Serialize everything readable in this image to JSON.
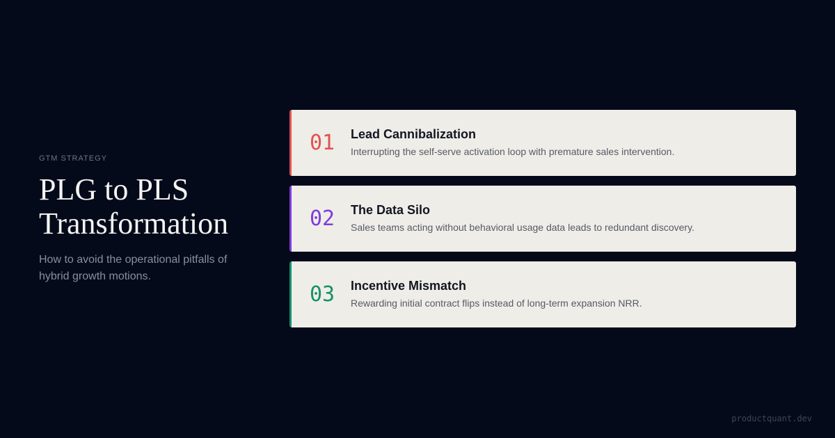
{
  "left": {
    "eyebrow": "GTM STRATEGY",
    "title_line1": "PLG to PLS",
    "title_line2": "Transformation",
    "subtitle": "How to avoid the operational pitfalls of hybrid growth motions."
  },
  "cards": [
    {
      "number": "01",
      "title": "Lead Cannibalization",
      "description": "Interrupting the self-serve activation loop with premature sales intervention.",
      "accent_color": "#e05252"
    },
    {
      "number": "02",
      "title": "The Data Silo",
      "description": "Sales teams acting without behavioral usage data leads to redundant discovery.",
      "accent_color": "#7e3ddb"
    },
    {
      "number": "03",
      "title": "Incentive Mismatch",
      "description": "Rewarding initial contract flips instead of long-term expansion NRR.",
      "accent_color": "#15926b"
    }
  ],
  "footer": {
    "brand": "productquant.dev"
  }
}
